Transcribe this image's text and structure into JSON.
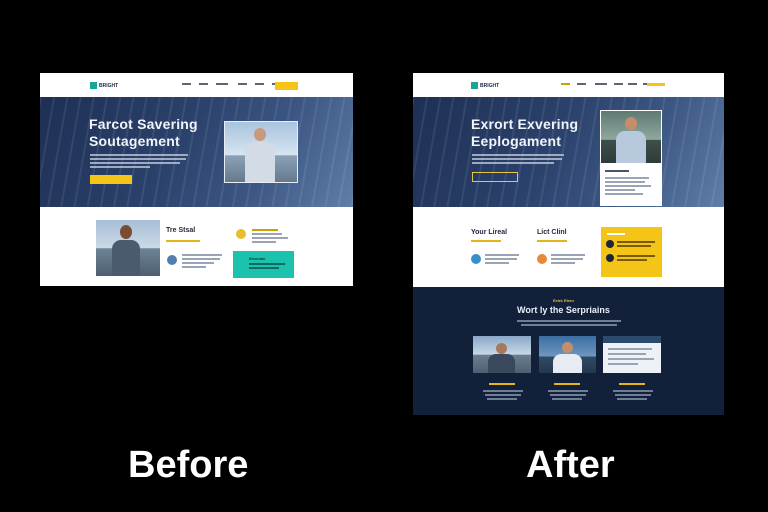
{
  "captions": {
    "before": "Before",
    "after": "After"
  },
  "colors": {
    "accent_yellow": "#F4C417",
    "accent_teal": "#1BC2AE",
    "hero_navy": "#1E2F55",
    "dark_section": "#13203A",
    "logo_green": "#1AA59A"
  },
  "before": {
    "logo": "BRIGHT",
    "hero_title_line1": "Farcot Savering",
    "hero_title_line2": "Soutagement",
    "feature_title": "Tre Stsal",
    "teal_card_title": "Iltsnnate"
  },
  "after": {
    "logo": "BRIGHT",
    "hero_title_line1": "Exrort Exvering",
    "hero_title_line2": "Eeplogament",
    "col1_title": "Your Lireal",
    "col2_title": "Lict Clinl",
    "dark_eyebrow": "Eelrk Etenr",
    "dark_title": "Wort ly the Serpriains"
  }
}
